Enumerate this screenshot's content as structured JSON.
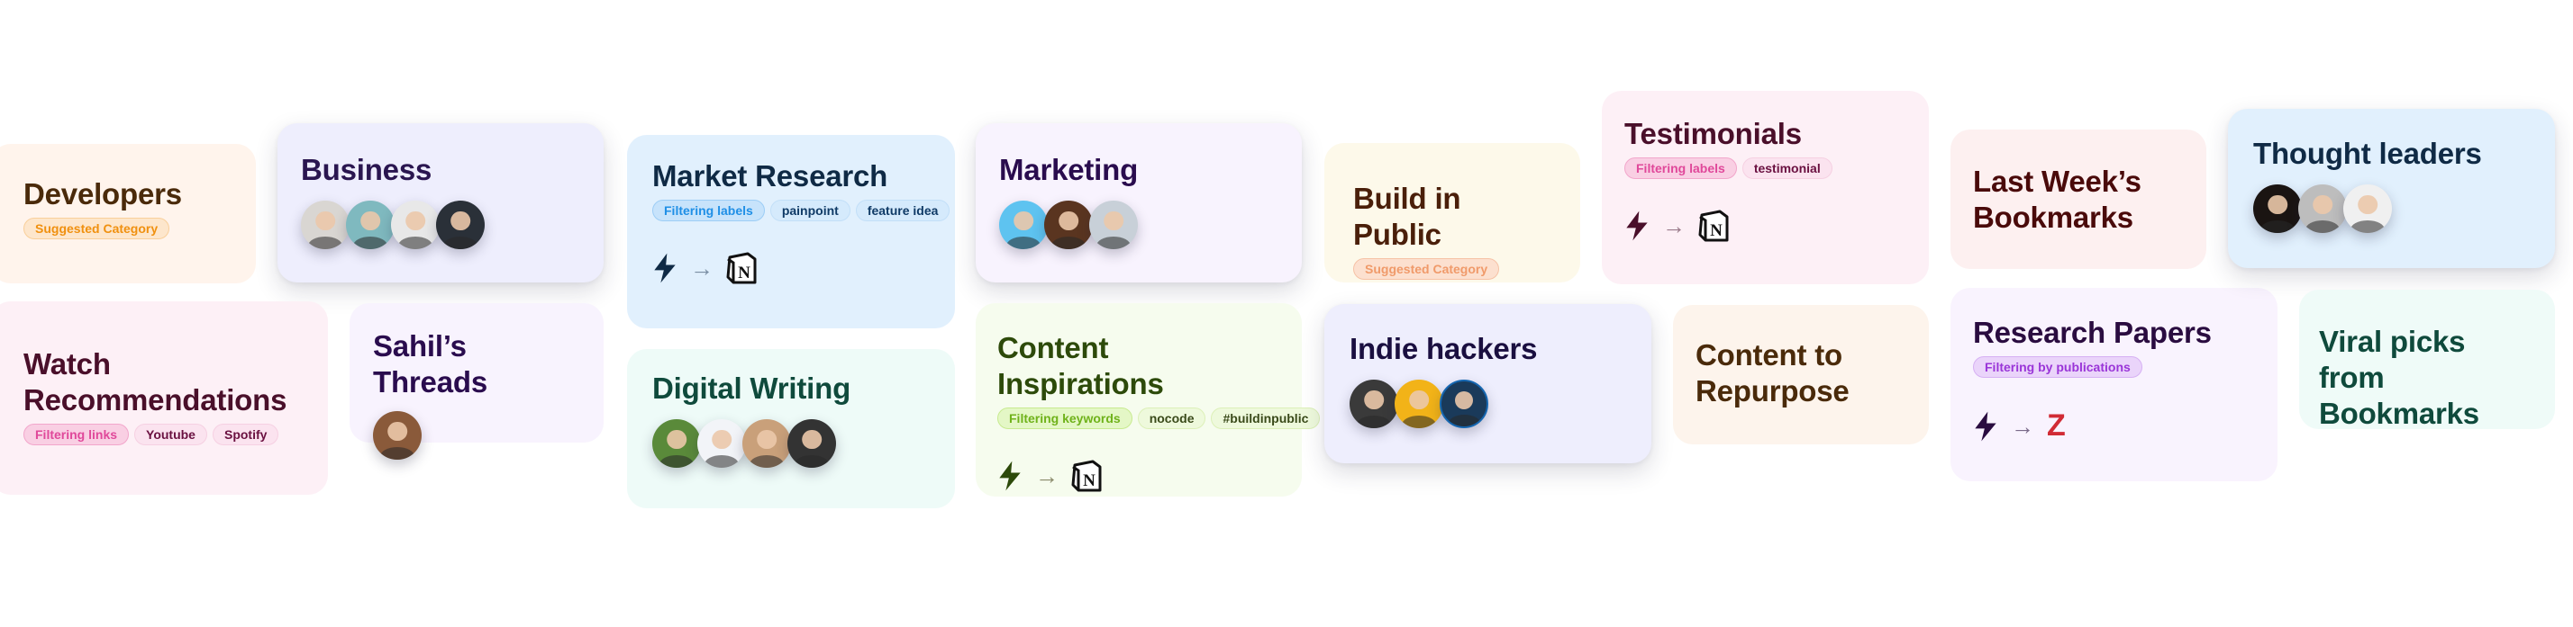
{
  "cards": {
    "developers": {
      "title": "Developers",
      "tags": [
        "Suggested Category"
      ],
      "bg": "#fff4ec",
      "title_color": "#4a2a0a"
    },
    "business": {
      "title": "Business",
      "avatars": 4,
      "bg": "#eeeefd",
      "title_color": "#2a1650"
    },
    "watch": {
      "title": "Watch Recommendations",
      "title_line1": "Watch",
      "title_line2": "Recommendations",
      "tags": [
        "Filtering links",
        "Youtube",
        "Spotify"
      ],
      "bg": "#fdf0f6",
      "title_color": "#4a0f2a"
    },
    "sahil": {
      "title": "Sahil’s Threads",
      "avatars": 1,
      "bg": "#f8f3fe",
      "title_color": "#2a0c4e"
    },
    "market": {
      "title": "Market Research",
      "tags": [
        "Filtering labels",
        "painpoint",
        "feature idea"
      ],
      "flow": {
        "from": "bolt-icon",
        "arrow": "→",
        "to": "notion-icon"
      },
      "bg": "#e1f0fd",
      "title_color": "#0f2a45"
    },
    "digital": {
      "title": "Digital Writing",
      "avatars": 4,
      "bg": "#eefbf8",
      "title_color": "#0f4a3c"
    },
    "marketing": {
      "title": "Marketing",
      "avatars": 3,
      "bg": "#f8f3fe",
      "title_color": "#2a0c4e"
    },
    "content_insp": {
      "title": "Content Inspirations",
      "tags": [
        "Filtering keywords",
        "nocode",
        "#buildinpublic"
      ],
      "flow": {
        "from": "bolt-icon",
        "arrow": "→",
        "to": "notion-icon"
      },
      "bg": "#f6fcee",
      "title_color": "#2d4a0a"
    },
    "build": {
      "title": "Build in Public",
      "tags": [
        "Suggested Category"
      ],
      "bg": "#fdf9ea",
      "title_color": "#4a1f0a"
    },
    "indie": {
      "title": "Indie hackers",
      "avatars": 3,
      "bg": "#eeeefd",
      "title_color": "#1a0f40"
    },
    "testimonials": {
      "title": "Testimonials",
      "tags": [
        "Filtering labels",
        "testimonial"
      ],
      "flow": {
        "from": "bolt-icon",
        "arrow": "→",
        "to": "notion-icon"
      },
      "bg": "#fdf0f6",
      "title_color": "#4a0f2a"
    },
    "repurpose": {
      "title_line1": "Content to",
      "title_line2": "Repurpose",
      "bg": "#fdf4ec",
      "title_color": "#4a2a0a"
    },
    "lastweek": {
      "title_line1": "Last Week’s",
      "title_line2": "Bookmarks",
      "bg": "#fdf0f0",
      "title_color": "#4a0a0a"
    },
    "research": {
      "title": "Research Papers",
      "tags": [
        "Filtering by publications"
      ],
      "flow": {
        "from": "bolt-icon",
        "arrow": "→",
        "to": "Z"
      },
      "bg": "#f9f3fe",
      "title_color": "#2a0c40"
    },
    "thought": {
      "title": "Thought leaders",
      "avatars": 3,
      "bg": "#e1f0fd",
      "title_color": "#0f2a45"
    },
    "viral": {
      "title_line1": "Viral picks from",
      "title_line2": "Bookmarks",
      "bg": "#effbf8",
      "title_color": "#0f4a3c"
    }
  }
}
